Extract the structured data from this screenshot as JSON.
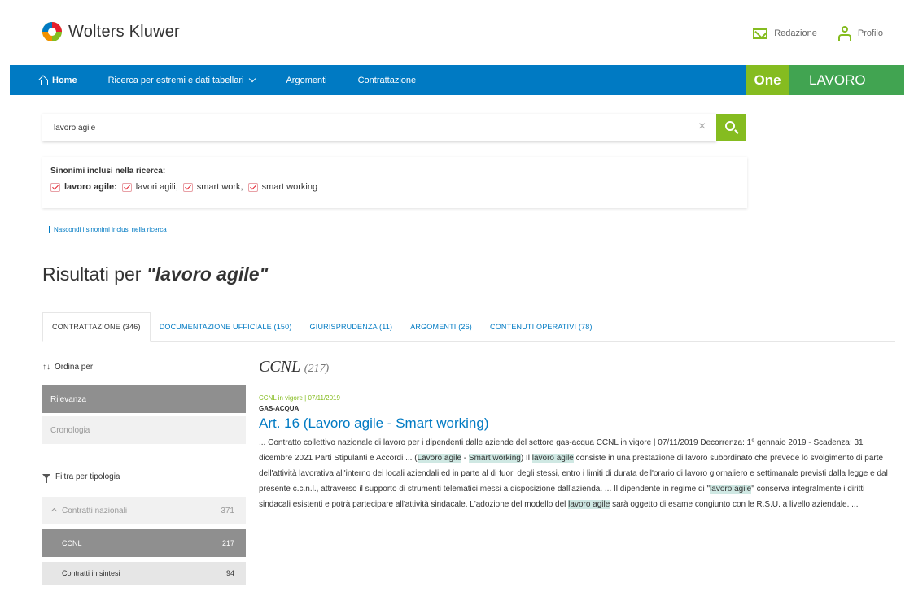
{
  "header": {
    "logo_text": "Wolters Kluwer",
    "links": [
      {
        "label": "Redazione",
        "icon": "mail-icon"
      },
      {
        "label": "Profilo",
        "icon": "user-icon"
      }
    ]
  },
  "nav": {
    "home": "Home",
    "ricerca": "Ricerca per estremi e dati tabellari",
    "argomenti": "Argomenti",
    "contrattazione": "Contrattazione",
    "brand_one": "One",
    "brand_lavoro": "LAVORO"
  },
  "search": {
    "value": "lavoro agile",
    "clear": "×"
  },
  "synonyms": {
    "title": "Sinonimi inclusi nella ricerca:",
    "items": [
      {
        "label": "lavoro agile:",
        "bold": true
      },
      {
        "label": "lavori agili,",
        "bold": false
      },
      {
        "label": "smart work,",
        "bold": false
      },
      {
        "label": "smart working",
        "bold": false
      }
    ],
    "toggle_label": "Nascondi i sinonimi inclusi nella ricerca"
  },
  "results": {
    "prefix": "Risultati per ",
    "query": "\"lavoro agile\""
  },
  "tabs": [
    {
      "label": "CONTRATTAZIONE (346)",
      "active": true
    },
    {
      "label": "DOCUMENTAZIONE UFFICIALE (150)",
      "active": false
    },
    {
      "label": "GIURISPRUDENZA (11)",
      "active": false
    },
    {
      "label": "ARGOMENTI (26)",
      "active": false
    },
    {
      "label": "CONTENUTI OPERATIVI (78)",
      "active": false
    }
  ],
  "sidebar": {
    "sort_label": "Ordina per",
    "sort_icon": "↑↓",
    "sort_options": [
      {
        "label": "Rilevanza",
        "active": true
      },
      {
        "label": "Cronologia",
        "active": false
      }
    ],
    "filter_label": "Filtra per tipologia",
    "filter_group": {
      "label": "Contratti nazionali",
      "count": "371"
    },
    "filter_sub": [
      {
        "label": "CCNL",
        "count": "217",
        "active": true
      },
      {
        "label": "Contratti in sintesi",
        "count": "94",
        "active": false
      }
    ]
  },
  "main": {
    "section_title": "CCNL",
    "section_count": "(217)",
    "result": {
      "status": "CCNL in vigore | 07/11/2019",
      "sector": "GAS-ACQUA",
      "title": "Art. 16 (Lavoro agile - Smart working)",
      "body": [
        {
          "t": "... Contratto collettivo nazionale di lavoro per i dipendenti dalle aziende del settore gas-acqua CCNL in vigore | 07/11/2019 Decorrenza: 1° gennaio 2019 - Scadenza: 31 dicembre 2021 Parti Stipulanti e Accordi ... (",
          "hl": false
        },
        {
          "t": "Lavoro agile",
          "hl": true
        },
        {
          "t": " - ",
          "hl": false
        },
        {
          "t": "Smart working",
          "hl": true
        },
        {
          "t": ") Il ",
          "hl": false
        },
        {
          "t": "lavoro agile",
          "hl": true
        },
        {
          "t": " consiste in una prestazione di lavoro subordinato che prevede lo svolgimento di parte dell'attività lavorativa all'interno dei locali aziendali ed in parte al di fuori degli stessi, entro i limiti di durata dell'orario di lavoro giornaliero e settimanale previsti dalla legge e dal presente c.c.n.l., attraverso il supporto di strumenti telematici messi a disposizione dall'azienda. ... Il dipendente in regime di \"",
          "hl": false
        },
        {
          "t": "lavoro agile",
          "hl": true
        },
        {
          "t": "\" conserva integralmente i diritti sindacali esistenti e potrà partecipare all'attività sindacale. L'adozione del modello del ",
          "hl": false
        },
        {
          "t": "lavoro agile",
          "hl": true
        },
        {
          "t": " sarà oggetto di esame congiunto con le R.S.U. a livello aziendale. ...",
          "hl": false
        }
      ]
    }
  },
  "colors": {
    "nav_blue": "#007ac3",
    "accent_green": "#85bc20",
    "brand_green": "#41a451",
    "highlight": "#cfe8e3"
  }
}
